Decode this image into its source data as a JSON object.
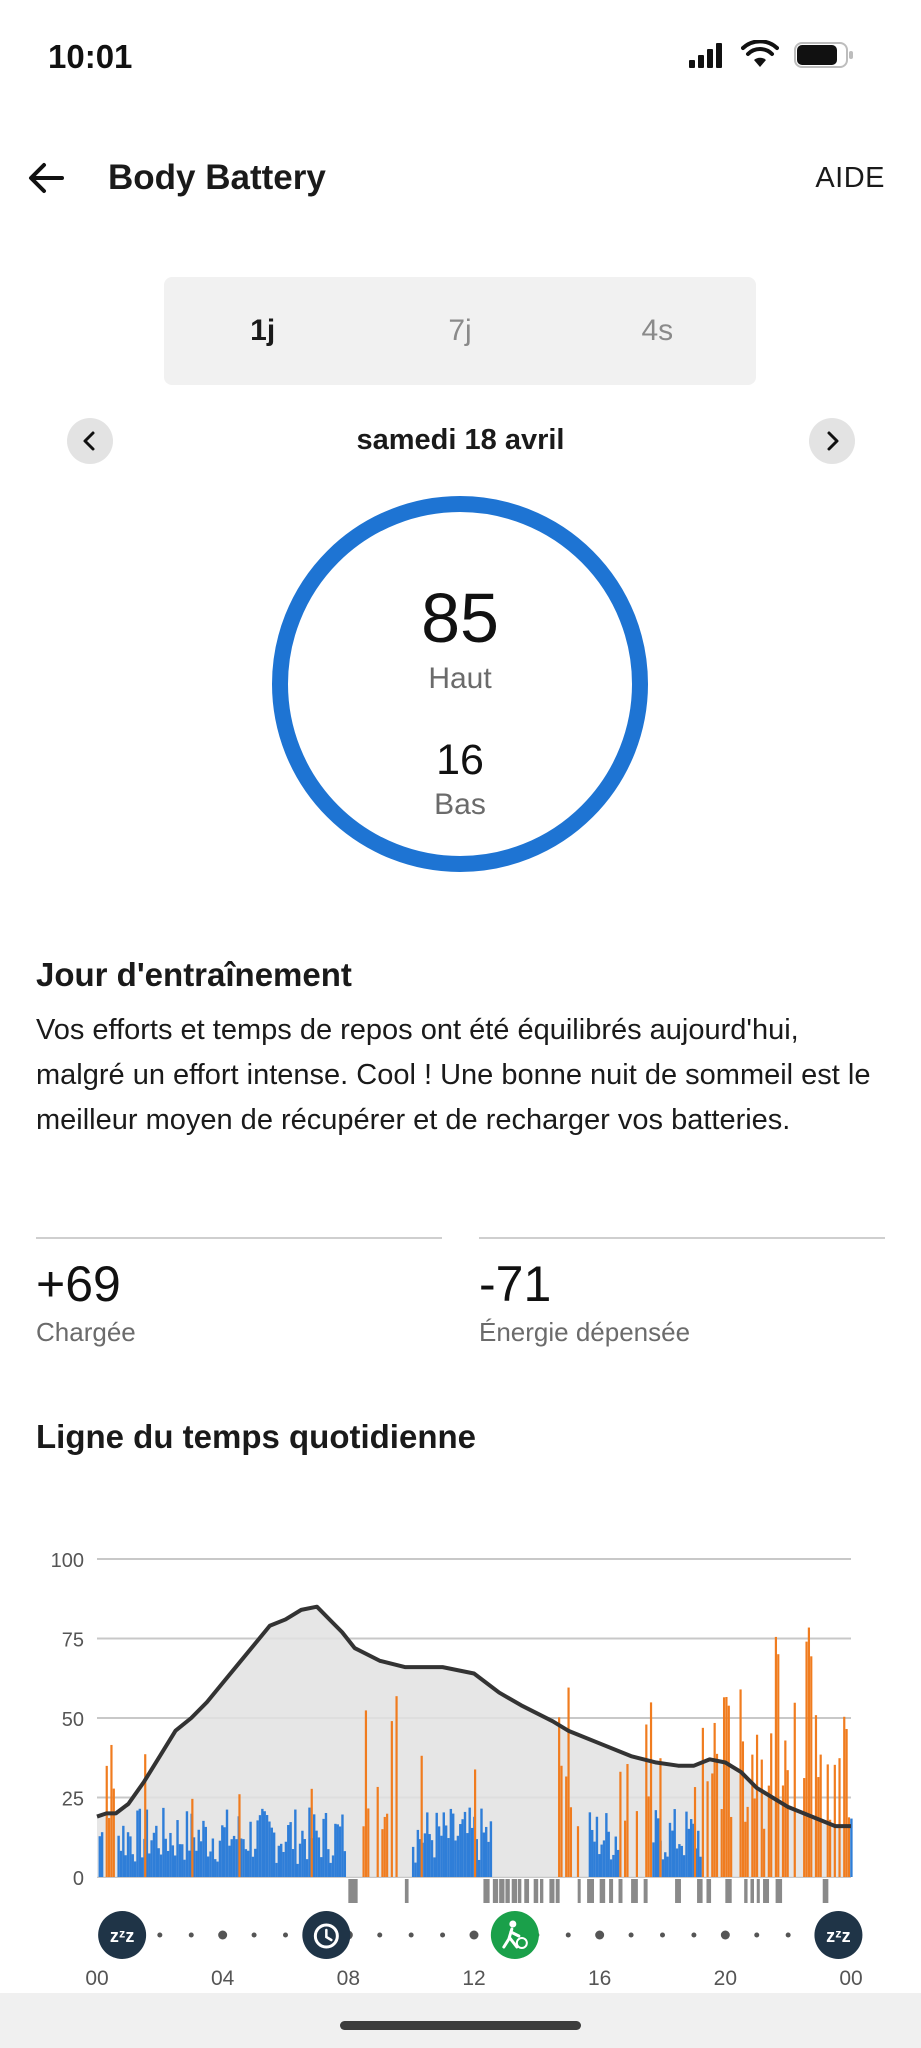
{
  "status_bar": {
    "time": "10:01",
    "icons": [
      "signal-icon",
      "wifi-icon",
      "battery-icon"
    ]
  },
  "app_bar": {
    "title": "Body Battery",
    "help": "AIDE"
  },
  "range_tabs": [
    {
      "label": "1j",
      "active": true
    },
    {
      "label": "7j",
      "active": false
    },
    {
      "label": "4s",
      "active": false
    }
  ],
  "date": {
    "label": "samedi 18 avril"
  },
  "gauge": {
    "high": "85",
    "high_label": "Haut",
    "low": "16",
    "low_label": "Bas",
    "color": "#1e74d3"
  },
  "insight": {
    "title": "Jour d'entraînement",
    "text": "Vos efforts et temps de repos ont été équilibrés aujourd'hui, malgré un effort intense. Cool ! Une bonne nuit de sommeil est le meilleur moyen de récupérer et de recharger vos batteries."
  },
  "stats": {
    "charged": {
      "value": "+69",
      "label": "Chargée"
    },
    "spent": {
      "value": "-71",
      "label": "Énergie dépensée"
    }
  },
  "timeline": {
    "title": "Ligne du temps quotidienne"
  },
  "colors": {
    "rest": "#2f7ed8",
    "stress": "#f07c1f",
    "line": "#333333",
    "area": "#e2e2e2",
    "activity": "#1aa04a",
    "sleep_marker": "#1f3447"
  },
  "chart_data": {
    "type": "line",
    "ylim": [
      0,
      100
    ],
    "yticks": [
      100,
      75,
      50,
      25,
      0
    ],
    "xticks": [
      "00",
      "04",
      "08",
      "12",
      "16",
      "20",
      "00"
    ],
    "x_range_hours": [
      0,
      24
    ],
    "body_battery": {
      "x_hours": [
        0,
        0.3,
        0.6,
        1,
        1.5,
        2,
        2.5,
        3,
        3.5,
        4,
        4.5,
        5,
        5.5,
        6,
        6.5,
        7,
        7.5,
        7.8,
        8.2,
        9,
        9.8,
        10.5,
        11,
        12,
        12.8,
        13.5,
        14.5,
        15,
        16,
        17,
        17.8,
        18.5,
        19,
        19.5,
        20,
        20.5,
        21,
        21.5,
        22,
        22.5,
        23,
        23.5,
        24
      ],
      "y": [
        19,
        20,
        20,
        23,
        30,
        38,
        46,
        50,
        55,
        61,
        67,
        73,
        79,
        81,
        84,
        85,
        80,
        77,
        72,
        68,
        66,
        66,
        66,
        64,
        58,
        54,
        49,
        46,
        42,
        38,
        36,
        35,
        35,
        37,
        36,
        33,
        28,
        25,
        22,
        20,
        18,
        16,
        16
      ]
    },
    "markers": [
      {
        "hour": 0.8,
        "type": "sleep",
        "icon": "sleep-icon"
      },
      {
        "hour": 7.3,
        "type": "alarm",
        "icon": "alarm-icon"
      },
      {
        "hour": 13.3,
        "type": "activity",
        "icon": "run-icon"
      },
      {
        "hour": 23.6,
        "type": "sleep",
        "icon": "sleep-icon"
      }
    ]
  }
}
